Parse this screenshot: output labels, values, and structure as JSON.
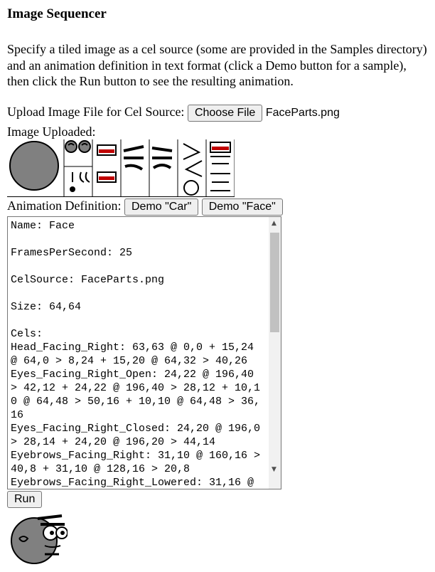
{
  "title": "Image Sequencer",
  "description": "Specify a tiled image as a cel source (some are provided in the Samples directory) and an animation definition in text format (click a Demo button for a sample), then click the Run button to see the resulting animation.",
  "upload": {
    "label": "Upload Image File for Cel Source:",
    "button": "Choose File",
    "filename": "FaceParts.png"
  },
  "uploaded_label": "Image Uploaded:",
  "animation": {
    "label": "Animation Definition:",
    "demo_car": "Demo \"Car\"",
    "demo_face": "Demo \"Face\"",
    "text": "Name: Face\n\nFramesPerSecond: 25\n\nCelSource: FaceParts.png\n\nSize: 64,64\n\nCels:\nHead_Facing_Right: 63,63 @ 0,0 + 15,24 @ 64,0 > 8,24 + 15,20 @ 64,32 > 40,26\nEyes_Facing_Right_Open: 24,22 @ 196,40 > 42,12 + 24,22 @ 196,40 > 28,12 + 10,10 @ 64,48 > 50,16 + 10,10 @ 64,48 > 36,16\nEyes_Facing_Right_Closed: 24,20 @ 196,0 > 28,14 + 24,20 @ 196,20 > 44,14\nEyebrows_Facing_Right: 31,10 @ 160,16 > 40,8 + 31,10 @ 128,16 > 20,8\nEyebrows_Facing_Right_Lowered: 31,16 @"
  },
  "run_button": "Run"
}
